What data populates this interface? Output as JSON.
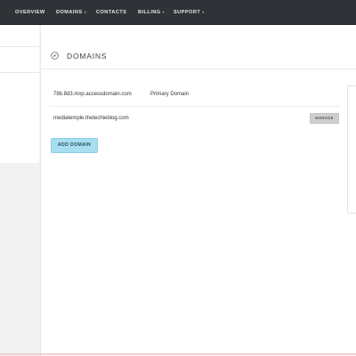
{
  "nav": {
    "items": [
      {
        "label": "OVERVIEW",
        "has_caret": false
      },
      {
        "label": "DOMAINS",
        "has_caret": true
      },
      {
        "label": "CONTACTS",
        "has_caret": false
      },
      {
        "label": "BILLING",
        "has_caret": true
      },
      {
        "label": "SUPPORT",
        "has_caret": true
      }
    ],
    "caret": "▾"
  },
  "page": {
    "title": "DOMAINS",
    "icon": "globe-icon"
  },
  "domains": [
    {
      "name": "78b.8d3.mxp.accessdomain.com",
      "type": "Primary Domain",
      "action": ""
    },
    {
      "name": "mediatemple.thetechieblog.com",
      "type": "",
      "action": "MANAGE"
    }
  ],
  "actions": {
    "add_domain_label": "ADD DOMAIN"
  },
  "colors": {
    "nav_bg": "#2f3236",
    "accent_button": "#a7def0",
    "manage_button": "#cfcfcf"
  }
}
